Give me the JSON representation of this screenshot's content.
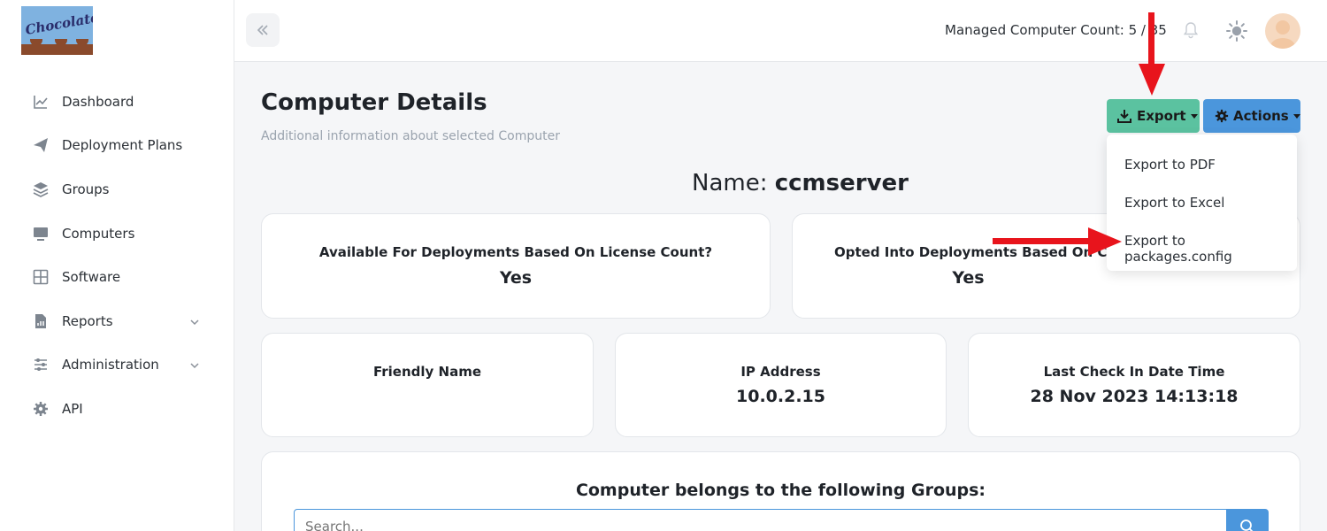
{
  "brand": {
    "logo_text": "Chocolatey"
  },
  "sidebar": {
    "items": [
      {
        "label": "Dashboard",
        "icon": "chart-line-icon"
      },
      {
        "label": "Deployment Plans",
        "icon": "paper-plane-icon"
      },
      {
        "label": "Groups",
        "icon": "layers-icon"
      },
      {
        "label": "Computers",
        "icon": "desktop-icon"
      },
      {
        "label": "Software",
        "icon": "grid-icon"
      },
      {
        "label": "Reports",
        "icon": "file-chart-icon",
        "expandable": true
      },
      {
        "label": "Administration",
        "icon": "sliders-icon",
        "expandable": true
      },
      {
        "label": "API",
        "icon": "gear-icon"
      }
    ]
  },
  "topbar": {
    "managed_count": "Managed Computer Count: 5 / 35"
  },
  "header": {
    "title": "Computer Details",
    "subtitle": "Additional information about selected Computer"
  },
  "toolbar": {
    "export_label": "Export",
    "actions_label": "Actions"
  },
  "export_menu": {
    "items": [
      "Export to PDF",
      "Export to Excel",
      "Export to packages.config"
    ]
  },
  "computer": {
    "name_prefix": "Name:",
    "name": "ccmserver"
  },
  "cards": {
    "license": {
      "label": "Available For Deployments Based On License Count?",
      "value": "Yes"
    },
    "opted": {
      "label": "Opted Into Deployments Based On Chocol",
      "value": "Yes"
    },
    "friendly": {
      "label": "Friendly Name",
      "value": ""
    },
    "ip": {
      "label": "IP Address",
      "value": "10.0.2.15"
    },
    "checkin": {
      "label": "Last Check In Date Time",
      "value": "28 Nov 2023 14:13:18"
    }
  },
  "groups": {
    "title": "Computer belongs to the following Groups:",
    "search_placeholder": "Search..."
  },
  "colors": {
    "export_button": "#5bc2a0",
    "actions_button": "#4b96dc",
    "annotation_arrow": "#e8141c"
  }
}
